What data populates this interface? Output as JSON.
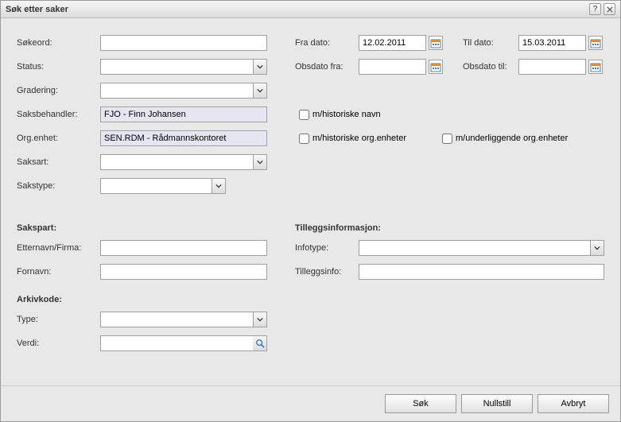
{
  "title": "Søk etter saker",
  "labels": {
    "sokeord": "Søkeord:",
    "status": "Status:",
    "gradering": "Gradering:",
    "saksbehandler": "Saksbehandler:",
    "orgenhet": "Org.enhet:",
    "saksart": "Saksart:",
    "sakstype": "Sakstype:",
    "fradato": "Fra dato:",
    "tildato": "Til dato:",
    "obsdatofra": "Obsdato fra:",
    "obsdatotil": "Obsdato til:",
    "mhist_navn": "m/historiske navn",
    "mhist_org": "m/historiske org.enheter",
    "munderl_org": "m/underliggende org.enheter",
    "sakspart": "Sakspart:",
    "etternavn": "Etternavn/Firma:",
    "fornavn": "Fornavn:",
    "tillegg": "Tilleggsinformasjon:",
    "infotype": "Infotype:",
    "tilleggsinfo": "Tilleggsinfo:",
    "arkivkode": "Arkivkode:",
    "type": "Type:",
    "verdi": "Verdi:"
  },
  "values": {
    "sokeord": "",
    "status": "",
    "gradering": "",
    "saksbehandler": "FJO - Finn Johansen",
    "orgenhet": "SEN.RDM - Rådmannskontoret",
    "saksart": "",
    "sakstype": "",
    "fradato": "12.02.2011",
    "tildato": "15.03.2011",
    "obsdatofra": "",
    "obsdatotil": "",
    "etternavn": "",
    "fornavn": "",
    "infotype": "",
    "tilleggsinfo": "",
    "type": "",
    "verdi": ""
  },
  "buttons": {
    "sok": "Søk",
    "nullstill": "Nullstill",
    "avbryt": "Avbryt"
  }
}
